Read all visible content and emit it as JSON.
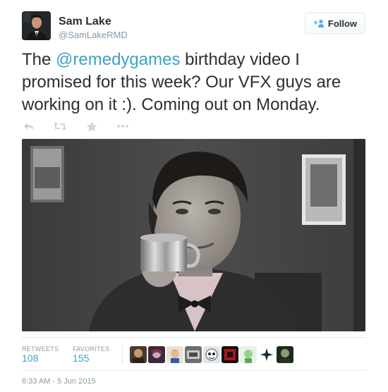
{
  "author": {
    "name": "Sam Lake",
    "handle": "@SamLakeRMD",
    "avatar_icon": "profile-photo"
  },
  "follow_button": {
    "label": "Follow",
    "icon": "follow-person-plus-icon",
    "color": "#55acee"
  },
  "tweet": {
    "text_before": "The ",
    "mention": "@remedygames",
    "text_after": " birthday video I promised for this week? Our VFX guys are working on it :). Coming out on Monday.",
    "mention_color": "#3ba3c8"
  },
  "actions": [
    {
      "name": "reply",
      "icon": "reply-icon"
    },
    {
      "name": "retweet",
      "icon": "retweet-icon"
    },
    {
      "name": "favorite",
      "icon": "star-icon"
    },
    {
      "name": "more",
      "icon": "more-icon"
    }
  ],
  "media": {
    "type": "photo",
    "subject": "man in suit and bow tie raising a metal cup"
  },
  "stats": {
    "retweets_label": "RETWEETS",
    "retweets_count": "108",
    "favorites_label": "FAVORITES",
    "favorites_count": "155"
  },
  "favorited_by_avatars": 9,
  "timestamp": "6:33 AM - 5 Jun 2015"
}
